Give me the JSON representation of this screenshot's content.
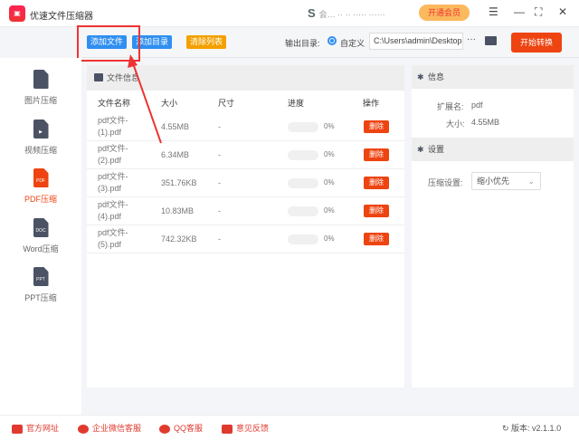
{
  "app": {
    "title": "优速文件压缩器",
    "user": "会… ·· ·· ····· ······",
    "vip": "开通会员"
  },
  "toolbar": {
    "add_file": "添加文件",
    "add_dir": "添加目录",
    "clear": "清除列表",
    "output_label": "输出目录:",
    "custom": "自定义",
    "path": "C:\\Users\\admin\\Desktop",
    "more": "···",
    "start": "开始转换"
  },
  "sidebar": [
    {
      "label": "图片压缩",
      "tag": ""
    },
    {
      "label": "视频压缩",
      "tag": "▶"
    },
    {
      "label": "PDF压缩",
      "tag": "PDF"
    },
    {
      "label": "Word压缩",
      "tag": "DOC"
    },
    {
      "label": "PPT压缩",
      "tag": "PPT"
    }
  ],
  "files": {
    "title": "文件信息",
    "columns": [
      "文件名称",
      "大小",
      "尺寸",
      "进度",
      "操作"
    ],
    "rows": [
      {
        "name": "pdf文件-(1).pdf",
        "size": "4.55MB",
        "dim": "-",
        "progress": "0%",
        "action": "删除"
      },
      {
        "name": "pdf文件-(2).pdf",
        "size": "6.34MB",
        "dim": "-",
        "progress": "0%",
        "action": "删除"
      },
      {
        "name": "pdf文件-(3).pdf",
        "size": "351.76KB",
        "dim": "-",
        "progress": "0%",
        "action": "删除"
      },
      {
        "name": "pdf文件-(4).pdf",
        "size": "10.83MB",
        "dim": "-",
        "progress": "0%",
        "action": "删除"
      },
      {
        "name": "pdf文件-(5).pdf",
        "size": "742.32KB",
        "dim": "-",
        "progress": "0%",
        "action": "删除"
      }
    ]
  },
  "info": {
    "title": "信息",
    "ext_label": "扩展名:",
    "ext": "pdf",
    "size_label": "大小:",
    "size": "4.55MB"
  },
  "settings": {
    "title": "设置",
    "label": "压缩设置:",
    "value": "缩小优先"
  },
  "footer": {
    "links": [
      "官方网址",
      "企业微信客服",
      "QQ客服",
      "意见反馈"
    ],
    "version": "版本: v2.1.1.0"
  }
}
